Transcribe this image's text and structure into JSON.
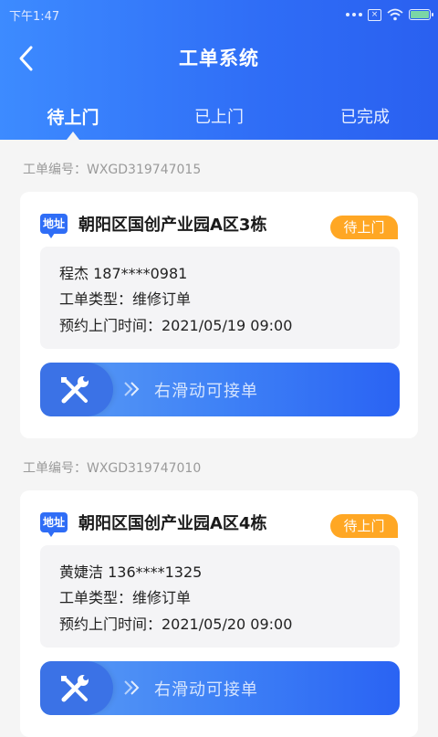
{
  "status_bar": {
    "time": "下午1:47"
  },
  "header": {
    "title": "工单系统"
  },
  "tabs": [
    {
      "label": "待上门",
      "active": true
    },
    {
      "label": "已上门",
      "active": false
    },
    {
      "label": "已完成",
      "active": false
    }
  ],
  "orders": [
    {
      "order_no": "工单编号：WXGD319747015",
      "address_badge": "地址",
      "address": "朝阳区国创产业园A区3栋",
      "status": "待上门",
      "contact": "程杰 187****0981",
      "type": "工单类型：维修订单",
      "appointment": "预约上门时间：2021/05/19 09:00",
      "slider_text": "右滑动可接单"
    },
    {
      "order_no": "工单编号：WXGD319747010",
      "address_badge": "地址",
      "address": "朝阳区国创产业园A区4栋",
      "status": "待上门",
      "contact": "黄婕洁 136****1325",
      "type": "工单类型：维修订单",
      "appointment": "预约上门时间：2021/05/20 09:00",
      "slider_text": "右滑动可接单"
    }
  ],
  "icons": {
    "back": "chevron-left-icon",
    "slider": "wrench-screwdriver-icon",
    "slide_hint": "double-chevron-right-icon"
  },
  "colors": {
    "brand": "#2f6df6",
    "status_tag": "#ffa724",
    "background": "#f5f5f5"
  }
}
